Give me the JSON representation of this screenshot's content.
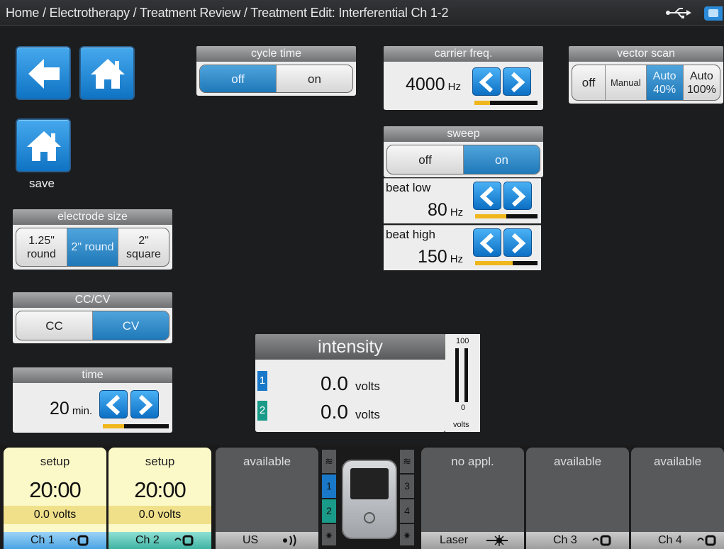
{
  "breadcrumb": "Home / Electrotherapy / Treatment Review / Treatment Edit: Interferential Ch 1-2",
  "buttons": {
    "save_label": "save"
  },
  "cycle_time": {
    "title": "cycle time",
    "options": [
      "off",
      "on"
    ],
    "selected": "off"
  },
  "carrier": {
    "title": "carrier freq.",
    "value": "4000",
    "unit": "Hz",
    "level": 0.25
  },
  "vector_scan": {
    "title": "vector scan",
    "options": [
      "off",
      "Manual",
      "Auto\n40%",
      "Auto\n100%"
    ],
    "selected": 2
  },
  "sweep": {
    "title": "sweep",
    "options": [
      "off",
      "on"
    ],
    "selected": "on",
    "beat_low": {
      "label": "beat low",
      "value": "80",
      "unit": "Hz",
      "level": 0.5
    },
    "beat_high": {
      "label": "beat high",
      "value": "150",
      "unit": "Hz",
      "level": 0.6
    }
  },
  "electrode": {
    "title": "electrode size",
    "options": [
      "1.25\"\nround",
      "2\" round",
      "2\"\nsquare"
    ],
    "selected": 1
  },
  "cccv": {
    "title": "CC/CV",
    "options": [
      "CC",
      "CV"
    ],
    "selected": 1
  },
  "time": {
    "title": "time",
    "value": "20",
    "unit": "min.",
    "level": 0.32
  },
  "intensity": {
    "title": "intensity",
    "ch1": {
      "chip": "1",
      "value": "0.0",
      "unit": "volts"
    },
    "ch2": {
      "chip": "2",
      "value": "0.0",
      "unit": "volts"
    },
    "scale_max": "100",
    "scale_min": "0",
    "scale_unit": "volts"
  },
  "channels": [
    {
      "status": "setup",
      "time": "20:00",
      "volts": "0.0 volts",
      "label": "Ch 1",
      "icon": "electrode-icon"
    },
    {
      "status": "setup",
      "time": "20:00",
      "volts": "0.0 volts",
      "label": "Ch 2",
      "icon": "electrode-icon"
    },
    {
      "status": "available",
      "label": "US",
      "icon": "ultrasound-icon"
    },
    {
      "status": "no appl.",
      "label": "Laser",
      "icon": "laser-icon"
    },
    {
      "status": "available",
      "label": "Ch 3",
      "icon": "electrode-icon"
    },
    {
      "status": "available",
      "label": "Ch 4",
      "icon": "electrode-icon"
    }
  ],
  "center_slots": {
    "left": [
      "1",
      "2"
    ],
    "right": [
      "3",
      "4"
    ]
  },
  "colors": {
    "accent": "#1f78b8",
    "ch1": "#1a78c8",
    "ch2": "#1a9a88",
    "bar_fill": "#f0b71c"
  }
}
